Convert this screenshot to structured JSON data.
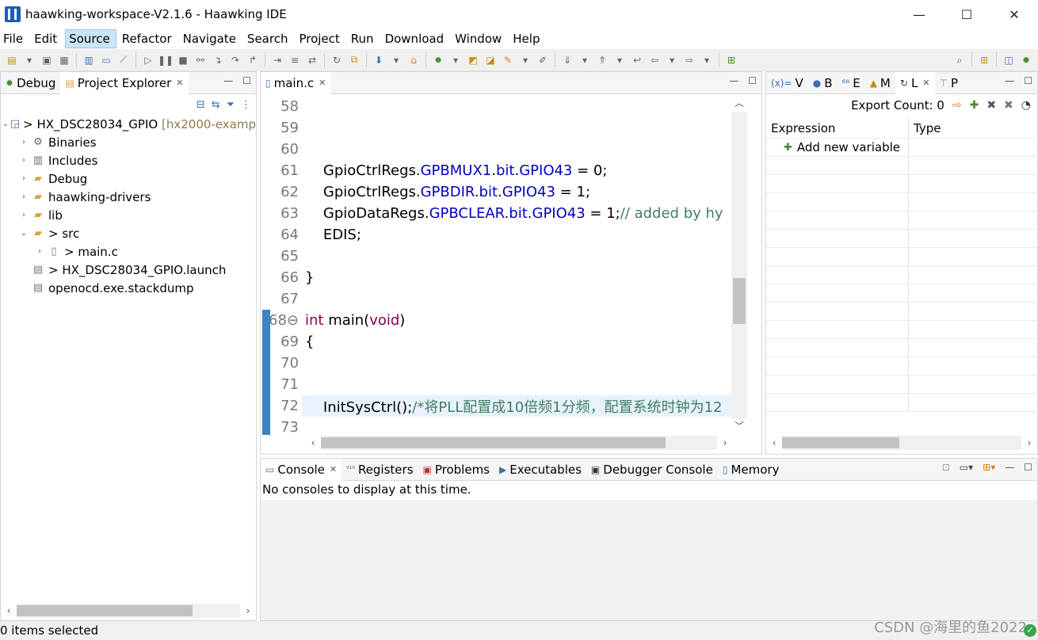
{
  "window": {
    "title": "haawking-workspace-V2.1.6 - Haawking IDE",
    "minimize": "—",
    "maximize": "☐",
    "close": "✕"
  },
  "menu": [
    "File",
    "Edit",
    "Source",
    "Refactor",
    "Navigate",
    "Search",
    "Project",
    "Run",
    "Download",
    "Window",
    "Help"
  ],
  "left_panel": {
    "tabs": [
      {
        "label": "Debug",
        "icon": "bug-icon"
      },
      {
        "label": "Project Explorer",
        "icon": "project-explorer-icon"
      }
    ],
    "tree": [
      {
        "label": "> HX_DSC28034_GPIO",
        "suffix": "[hx2000-examp",
        "depth": 0,
        "expanded": true,
        "icon": "project-icon"
      },
      {
        "label": "Binaries",
        "depth": 1,
        "expanded": false,
        "icon": "binaries-icon"
      },
      {
        "label": "Includes",
        "depth": 1,
        "expanded": false,
        "icon": "includes-icon"
      },
      {
        "label": "Debug",
        "depth": 1,
        "expanded": false,
        "icon": "folder-icon"
      },
      {
        "label": "haawking-drivers",
        "depth": 1,
        "expanded": false,
        "icon": "folder-icon"
      },
      {
        "label": "lib",
        "depth": 1,
        "expanded": false,
        "icon": "folder-icon"
      },
      {
        "label": "> src",
        "depth": 1,
        "expanded": true,
        "icon": "folder-icon"
      },
      {
        "label": "> main.c",
        "depth": 2,
        "expanded": false,
        "icon": "c-file-icon"
      },
      {
        "label": "> HX_DSC28034_GPIO.launch",
        "depth": 1,
        "expanded": null,
        "icon": "launch-file-icon"
      },
      {
        "label": "openocd.exe.stackdump",
        "depth": 1,
        "expanded": null,
        "icon": "file-icon"
      }
    ]
  },
  "editor": {
    "tab": "main.c",
    "lines": [
      {
        "n": "58",
        "html": ""
      },
      {
        "n": "59",
        "html": ""
      },
      {
        "n": "60",
        "html": ""
      },
      {
        "n": "61",
        "html": "&nbsp;&nbsp;&nbsp;&nbsp;GpioCtrlRegs.<span class='fld'>GPBMUX1</span>.<span class='fld'>bit</span>.<span class='fld'>GPIO43</span> = 0;"
      },
      {
        "n": "62",
        "html": "&nbsp;&nbsp;&nbsp;&nbsp;GpioCtrlRegs.<span class='fld'>GPBDIR</span>.<span class='fld'>bit</span>.<span class='fld'>GPIO43</span> = 1;"
      },
      {
        "n": "63",
        "html": "&nbsp;&nbsp;&nbsp;&nbsp;GpioDataRegs.<span class='fld'>GPBCLEAR</span>.<span class='fld'>bit</span>.<span class='fld'>GPIO43</span> = 1;<span class='cmt'>// added by hy</span>"
      },
      {
        "n": "64",
        "html": "&nbsp;&nbsp;&nbsp;&nbsp;EDIS;"
      },
      {
        "n": "65",
        "html": ""
      },
      {
        "n": "66",
        "html": "}"
      },
      {
        "n": "67",
        "html": ""
      },
      {
        "n": "68⊖",
        "html": "<span class='kw'>int</span> main(<span class='kw'>void</span>)",
        "mark": true
      },
      {
        "n": "69",
        "html": "{",
        "mark": true
      },
      {
        "n": "70",
        "html": "",
        "mark": true
      },
      {
        "n": "71",
        "html": "",
        "mark": true
      },
      {
        "n": "72",
        "html": "&nbsp;&nbsp;&nbsp;&nbsp;InitSysCtrl();<span class='cmt'>/*将PLL配置成10倍频1分频，配置系统时钟为12</span>",
        "mark": true,
        "highlight": true
      },
      {
        "n": "73",
        "html": "",
        "mark": true
      }
    ]
  },
  "expressions": {
    "tabs": [
      "V",
      "B",
      "E",
      "M",
      "L",
      "P"
    ],
    "export_count": "Export Count: 0",
    "columns": [
      "Expression",
      "Type"
    ],
    "add_new": "Add new variable"
  },
  "console": {
    "tabs": [
      "Console",
      "Registers",
      "Problems",
      "Executables",
      "Debugger Console",
      "Memory"
    ],
    "message": "No consoles to display at this time."
  },
  "status": {
    "text": "0 items selected",
    "watermark": "CSDN @海里的鱼2022"
  }
}
